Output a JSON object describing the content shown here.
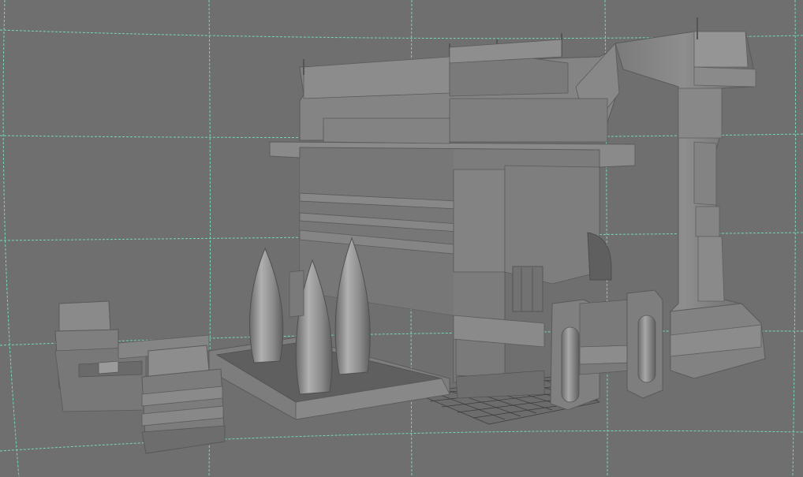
{
  "viewport": {
    "background_color": "#6f6f6f",
    "grid_color": "#74d7b9",
    "ground_grid_color": "#3a3a3a",
    "shading_color": "#8a8a8a",
    "view_mode": "perspective",
    "grid_visible": true,
    "shading_mode": "smooth-shaded"
  },
  "scene": {
    "objects": [
      "main-building",
      "tall-tower",
      "left-tower-section",
      "roof-platform",
      "spire-platform",
      "spire-left",
      "spire-center",
      "spire-right",
      "left-structure",
      "right-cylinder-left",
      "right-cylinder-right",
      "ground-grid-patch"
    ]
  }
}
